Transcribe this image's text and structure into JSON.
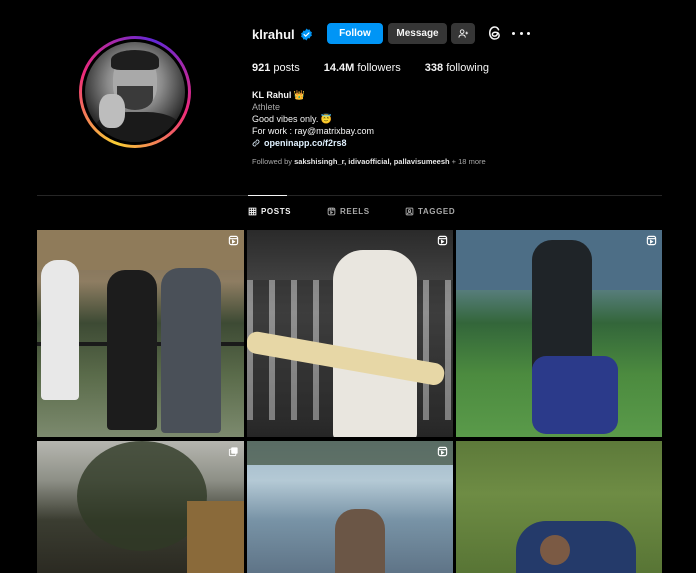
{
  "profile": {
    "username": "klrahul",
    "follow_label": "Follow",
    "message_label": "Message",
    "stats": {
      "posts_count": "921",
      "posts_label": "posts",
      "followers_count": "14.4M",
      "followers_label": "followers",
      "following_count": "338",
      "following_label": "following"
    },
    "bio": {
      "name": "KL Rahul",
      "name_emoji": "👑",
      "category": "Athlete",
      "line1": "Good vibes only. 😇",
      "line2": "For work : ray@matrixbay.com",
      "link": "openinapp.co/f2rs8"
    },
    "followed_by": {
      "prefix": "Followed by ",
      "names": "sakshisingh_r, idivaofficial, pallavisumeesh",
      "suffix": " + 18 more"
    }
  },
  "tabs": [
    {
      "label": "POSTS",
      "icon": "grid-icon",
      "active": true
    },
    {
      "label": "REELS",
      "icon": "reels-icon",
      "active": false
    },
    {
      "label": "TAGGED",
      "icon": "tagged-icon",
      "active": false
    }
  ],
  "posts": [
    {
      "type": "reel"
    },
    {
      "type": "reel"
    },
    {
      "type": "reel"
    },
    {
      "type": "carousel"
    },
    {
      "type": "reel"
    },
    {
      "type": "photo"
    }
  ],
  "colors": {
    "background": "#000000",
    "follow_button": "#0095f6",
    "secondary_button": "#363636",
    "verified": "#0095f6",
    "muted_text": "#a8a8a8"
  }
}
